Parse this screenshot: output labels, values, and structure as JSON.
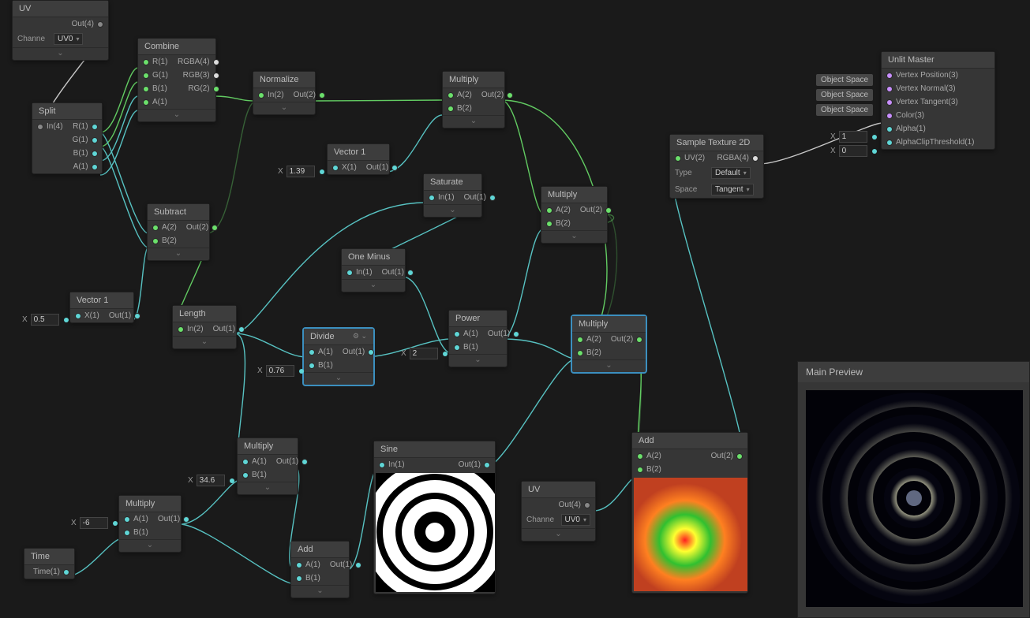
{
  "preview_title": "Main Preview",
  "nodes": {
    "uv1": {
      "title": "UV",
      "outs": [
        "Out(4)"
      ],
      "channel_label": "Channe",
      "channel_value": "UV0"
    },
    "split": {
      "title": "Split",
      "ins": [
        "In(4)"
      ],
      "outs": [
        "R(1)",
        "G(1)",
        "B(1)",
        "A(1)"
      ]
    },
    "combine": {
      "title": "Combine",
      "ins": [
        "R(1)",
        "G(1)",
        "B(1)",
        "A(1)"
      ],
      "outs": [
        "RGBA(4)",
        "RGB(3)",
        "RG(2)"
      ]
    },
    "normalize": {
      "title": "Normalize",
      "ins": [
        "In(2)"
      ],
      "outs": [
        "Out(2)"
      ]
    },
    "vector1a": {
      "title": "Vector 1",
      "ins": [
        "X(1)"
      ],
      "outs": [
        "Out(1)"
      ],
      "xfield": "1.39"
    },
    "multiply1": {
      "title": "Multiply",
      "ins": [
        "A(2)",
        "B(2)"
      ],
      "outs": [
        "Out(2)"
      ]
    },
    "saturate": {
      "title": "Saturate",
      "ins": [
        "In(1)"
      ],
      "outs": [
        "Out(1)"
      ]
    },
    "oneminus": {
      "title": "One Minus",
      "ins": [
        "In(1)"
      ],
      "outs": [
        "Out(1)"
      ]
    },
    "subtract": {
      "title": "Subtract",
      "ins": [
        "A(2)",
        "B(2)"
      ],
      "outs": [
        "Out(2)"
      ]
    },
    "vector1b": {
      "title": "Vector 1",
      "ins": [
        "X(1)"
      ],
      "outs": [
        "Out(1)"
      ],
      "xfield": "0.5"
    },
    "length": {
      "title": "Length",
      "ins": [
        "In(2)"
      ],
      "outs": [
        "Out(1)"
      ]
    },
    "divide": {
      "title": "Divide",
      "ins": [
        "A(1)",
        "B(1)"
      ],
      "outs": [
        "Out(1)"
      ],
      "xfield": "0.76"
    },
    "power": {
      "title": "Power",
      "ins": [
        "A(1)",
        "B(1)"
      ],
      "outs": [
        "Out(1)"
      ],
      "xfield": "2"
    },
    "multiply2": {
      "title": "Multiply",
      "ins": [
        "A(2)",
        "B(2)"
      ],
      "outs": [
        "Out(2)"
      ]
    },
    "multiply3": {
      "title": "Multiply",
      "ins": [
        "A(2)",
        "B(2)"
      ],
      "outs": [
        "Out(2)"
      ]
    },
    "multiply4": {
      "title": "Multiply",
      "ins": [
        "A(1)",
        "B(1)"
      ],
      "outs": [
        "Out(1)"
      ],
      "xfield": "34.6"
    },
    "multiply5": {
      "title": "Multiply",
      "ins": [
        "A(1)",
        "B(1)"
      ],
      "outs": [
        "Out(1)"
      ],
      "xfield": "-6"
    },
    "time": {
      "title": "Time",
      "outs": [
        "Time(1)"
      ]
    },
    "add1": {
      "title": "Add",
      "ins": [
        "A(1)",
        "B(1)"
      ],
      "outs": [
        "Out(1)"
      ]
    },
    "sine": {
      "title": "Sine",
      "ins": [
        "In(1)"
      ],
      "outs": [
        "Out(1)"
      ]
    },
    "uv2": {
      "title": "UV",
      "outs": [
        "Out(4)"
      ],
      "channel_label": "Channe",
      "channel_value": "UV0"
    },
    "add2": {
      "title": "Add",
      "ins": [
        "A(2)",
        "B(2)"
      ],
      "outs": [
        "Out(2)"
      ]
    },
    "sampletex": {
      "title": "Sample Texture 2D",
      "ins": [
        "UV(2)"
      ],
      "outs": [
        "RGBA(4)"
      ],
      "type_label": "Type",
      "type_value": "Default",
      "space_label": "Space",
      "space_value": "Tangent"
    },
    "unlit": {
      "title": "Unlit Master",
      "ports": [
        "Vertex Position(3)",
        "Vertex Normal(3)",
        "Vertex Tangent(3)",
        "Color(3)",
        "Alpha(1)",
        "AlphaClipThreshold(1)"
      ],
      "badges": [
        "Object Space",
        "Object Space",
        "Object Space"
      ],
      "x1_lbl": "X",
      "x1_val": "1",
      "x0_lbl": "X",
      "x0_val": "0"
    }
  },
  "x_label": "X"
}
